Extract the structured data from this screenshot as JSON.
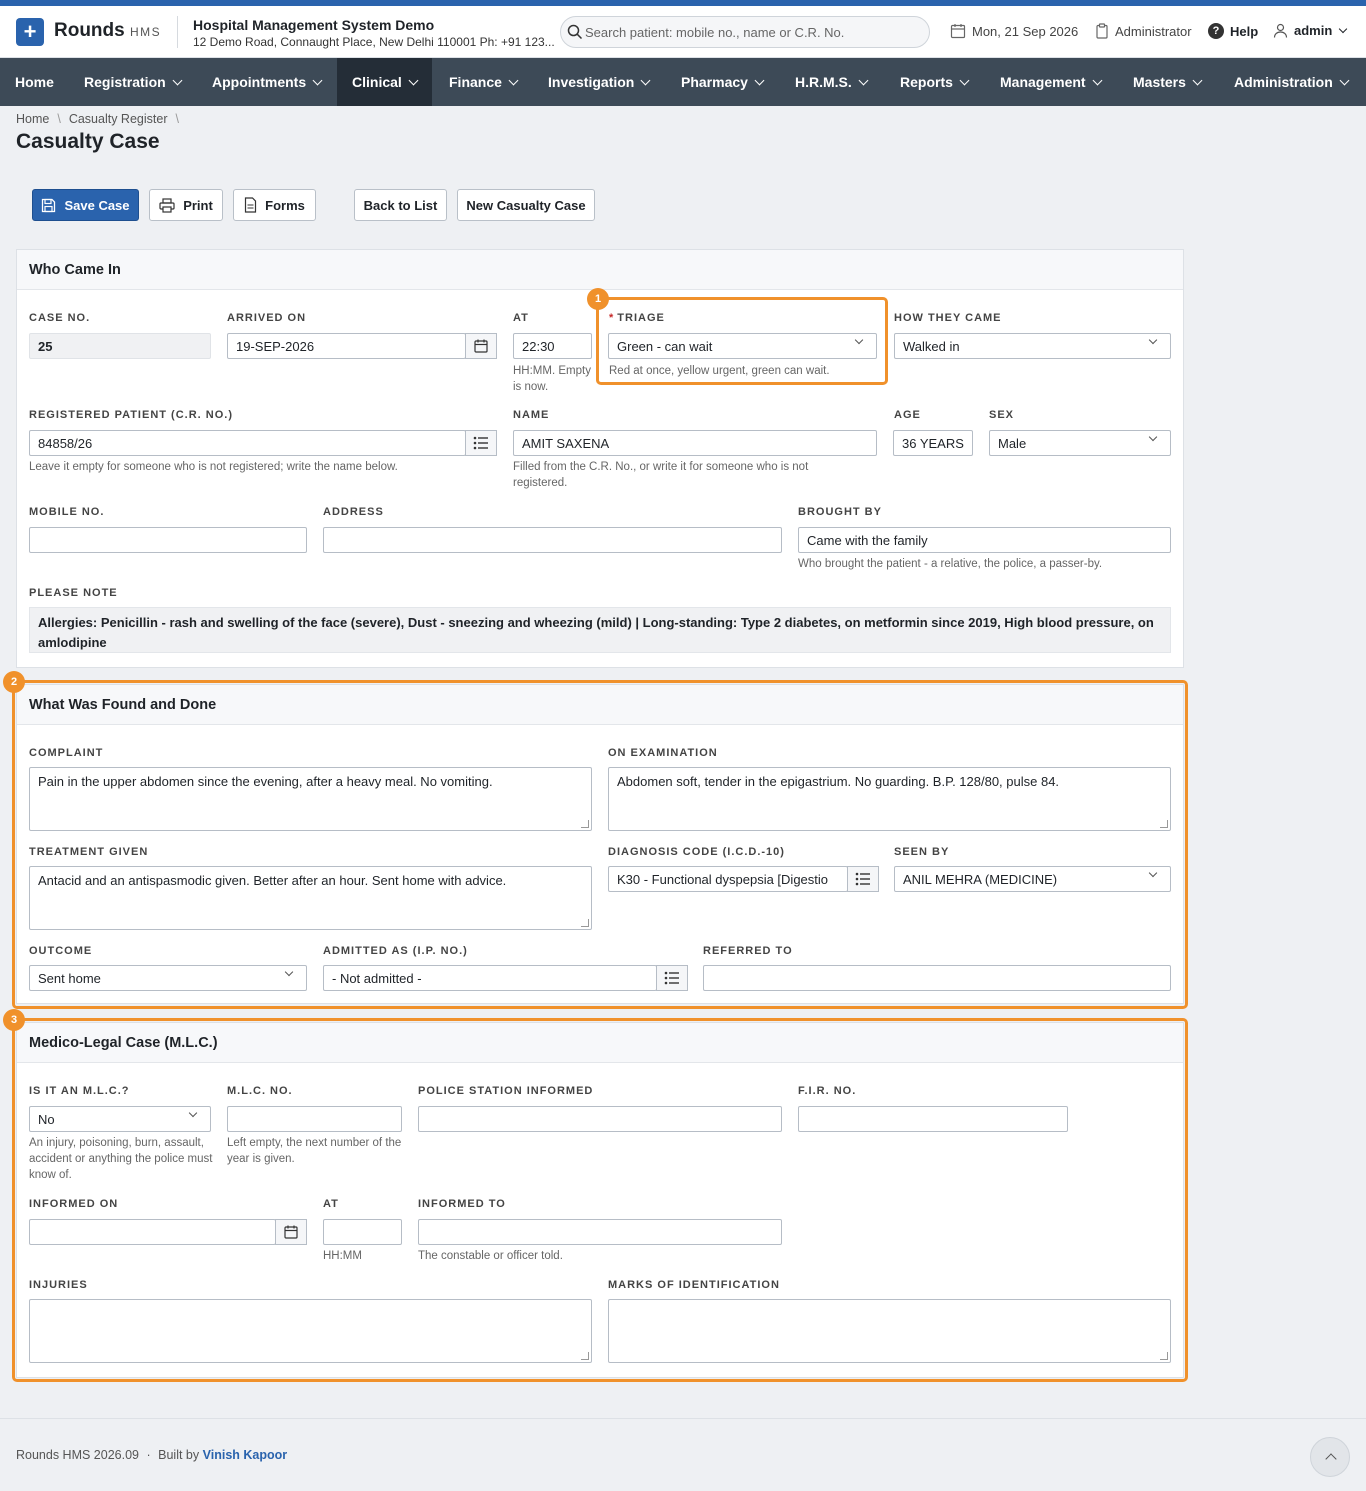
{
  "brand": {
    "name": "Rounds",
    "sub": "HMS",
    "logo": "+"
  },
  "hospital": {
    "name": "Hospital Management System Demo",
    "address": "12 Demo Road, Connaught Place, New Delhi 110001 Ph: +91 123..."
  },
  "search": {
    "placeholder": "Search patient: mobile no., name or C.R. No."
  },
  "header": {
    "date": "Mon, 21 Sep 2026",
    "role": "Administrator",
    "help": "Help",
    "user": "admin"
  },
  "nav": [
    "Home",
    "Registration",
    "Appointments",
    "Clinical",
    "Finance",
    "Investigation",
    "Pharmacy",
    "H.R.M.S.",
    "Reports",
    "Management",
    "Masters",
    "Administration"
  ],
  "breadcrumb": {
    "home": "Home",
    "sep": "\\",
    "section": "Casualty Register"
  },
  "page": {
    "title": "Casualty Case"
  },
  "toolbar": {
    "save": "Save Case",
    "print": "Print",
    "forms": "Forms",
    "back": "Back to List",
    "new": "New Casualty Case"
  },
  "who": {
    "title": "Who Came In",
    "case_no_label": "CASE NO.",
    "case_no": "25",
    "arrived_label": "ARRIVED ON",
    "arrived": "19-SEP-2026",
    "at_label": "AT",
    "at": "22:30",
    "at_help": "HH:MM. Empty is now.",
    "triage_label": "TRIAGE",
    "triage_required": "*",
    "triage": "Green - can wait",
    "triage_help": "Red at once, yellow urgent, green can wait.",
    "how_label": "HOW THEY CAME",
    "how": "Walked in",
    "crno_label": "REGISTERED PATIENT (C.R. NO.)",
    "crno": "84858/26",
    "crno_help": "Leave it empty for someone who is not registered; write the name below.",
    "name_label": "NAME",
    "name": "AMIT SAXENA",
    "name_help": "Filled from the C.R. No., or write it for someone who is not registered.",
    "age_label": "AGE",
    "age": "36 YEARS",
    "sex_label": "SEX",
    "sex": "Male",
    "mobile_label": "MOBILE NO.",
    "mobile": "",
    "address_label": "ADDRESS",
    "address": "",
    "brought_label": "BROUGHT BY",
    "brought": "Came with the family",
    "brought_help": "Who brought the patient - a relative, the police, a passer-by.",
    "note_label": "PLEASE NOTE",
    "note": "Allergies: Penicillin - rash and swelling of the face (severe), Dust - sneezing and wheezing (mild) | Long-standing: Type 2 diabetes, on metformin since 2019, High blood pressure, on amlodipine"
  },
  "found": {
    "title": "What Was Found and Done",
    "complaint_label": "COMPLAINT",
    "complaint": "Pain in the upper abdomen since the evening, after a heavy meal. No vomiting.",
    "exam_label": "ON EXAMINATION",
    "exam": "Abdomen soft, tender in the epigastrium. No guarding. B.P. 128/80, pulse 84.",
    "treatment_label": "TREATMENT GIVEN",
    "treatment": "Antacid and an antispasmodic given. Better after an hour. Sent home with advice.",
    "diag_label": "DIAGNOSIS CODE (I.C.D.-10)",
    "diag": "K30 - Functional dyspepsia [Digestio",
    "seen_label": "SEEN BY",
    "seen": "ANIL MEHRA (MEDICINE)",
    "outcome_label": "OUTCOME",
    "outcome": "Sent home",
    "admitted_label": "ADMITTED AS (I.P. NO.)",
    "admitted": "- Not admitted -",
    "referred_label": "REFERRED TO",
    "referred": ""
  },
  "mlc": {
    "title": "Medico-Legal Case (M.L.C.)",
    "is_label": "IS IT AN M.L.C.?",
    "is": "No",
    "is_help": "An injury, poisoning, burn, assault, accident or anything the police must know of.",
    "no_label": "M.L.C. NO.",
    "no_help": "Left empty, the next number of the year is given.",
    "police_label": "POLICE STATION INFORMED",
    "fir_label": "F.I.R. NO.",
    "informed_on_label": "INFORMED ON",
    "at_label": "AT",
    "at_help": "HH:MM",
    "informed_to_label": "INFORMED TO",
    "informed_to_help": "The constable or officer told.",
    "injuries_label": "INJURIES",
    "marks_label": "MARKS OF IDENTIFICATION"
  },
  "badges": [
    "1",
    "2",
    "3"
  ],
  "footer": {
    "version": "Rounds HMS 2026.09",
    "sep": "·",
    "built": "Built by",
    "author": "Vinish Kapoor"
  },
  "colors": {
    "primary": "#2a63ad",
    "nav": "#3d4a57",
    "highlight": "#f0912b",
    "required": "#c62828"
  }
}
